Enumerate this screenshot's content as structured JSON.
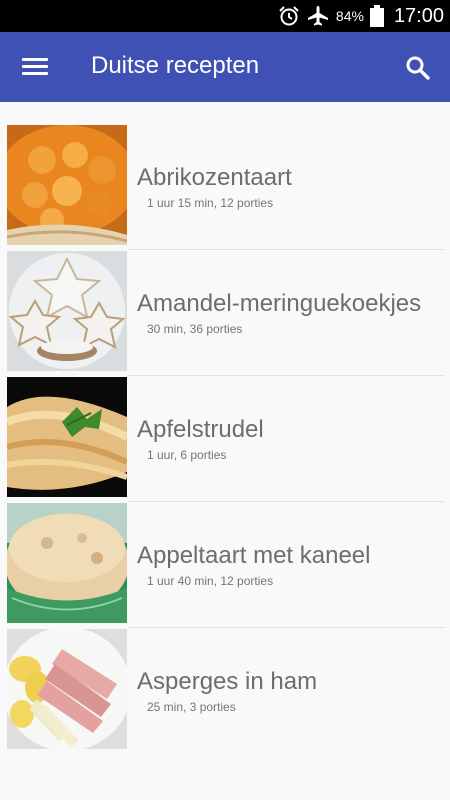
{
  "status_bar": {
    "battery_percent": "84%",
    "time": "17:00",
    "icons": [
      "alarm-icon",
      "airplane-mode-icon",
      "battery-icon"
    ]
  },
  "app_bar": {
    "title": "Duitse recepten",
    "icons": [
      "menu-icon",
      "search-icon"
    ],
    "color": "#3f51b5"
  },
  "recipes": [
    {
      "title": "Abrikozentaart",
      "details": "1 uur 15 min, 12 porties"
    },
    {
      "title": "Amandel-meringuekoekjes",
      "details": "30 min, 36 porties"
    },
    {
      "title": "Apfelstrudel",
      "details": "1 uur, 6 porties"
    },
    {
      "title": "Appeltaart met kaneel",
      "details": "1 uur 40 min, 12 porties"
    },
    {
      "title": "Asperges in ham",
      "details": "25 min, 3 porties"
    }
  ]
}
